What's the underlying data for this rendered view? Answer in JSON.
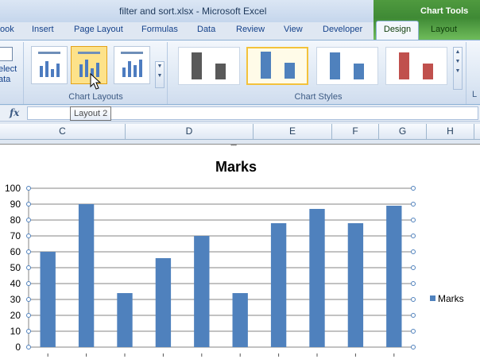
{
  "window": {
    "title": "filter and sort.xlsx  -  Microsoft Excel",
    "context_title": "Chart Tools"
  },
  "tabs": [
    {
      "label": "ook"
    },
    {
      "label": "Insert"
    },
    {
      "label": "Page Layout"
    },
    {
      "label": "Formulas"
    },
    {
      "label": "Data"
    },
    {
      "label": "Review"
    },
    {
      "label": "View"
    },
    {
      "label": "Developer"
    },
    {
      "label": "Design"
    },
    {
      "label": "Layout"
    }
  ],
  "ribbon": {
    "select_data_label": "elect\nata",
    "groups": {
      "chart_layouts": "Chart Layouts",
      "chart_styles": "Chart Styles",
      "partial": "L"
    },
    "style_colors": [
      "#595959",
      "#4f81bd",
      "#4f81bd",
      "#c0504d"
    ]
  },
  "tooltip": {
    "text": "Layout 2"
  },
  "formula_bar": {
    "fx": "fx",
    "value": ""
  },
  "columns": [
    "C",
    "D",
    "E",
    "F",
    "G",
    "H"
  ],
  "chart_data": {
    "type": "bar",
    "title": "Marks",
    "values": [
      60,
      90,
      34,
      56,
      70,
      34,
      78,
      87,
      78,
      89
    ],
    "ylim": [
      0,
      100
    ],
    "yticks": [
      0,
      10,
      20,
      30,
      40,
      50,
      60,
      70,
      80,
      90,
      100
    ],
    "series": [
      {
        "name": "Marks",
        "values": [
          60,
          90,
          34,
          56,
          70,
          34,
          78,
          87,
          78,
          89
        ]
      }
    ],
    "bar_color": "#4f81bd",
    "grid": true,
    "legend": "right"
  }
}
